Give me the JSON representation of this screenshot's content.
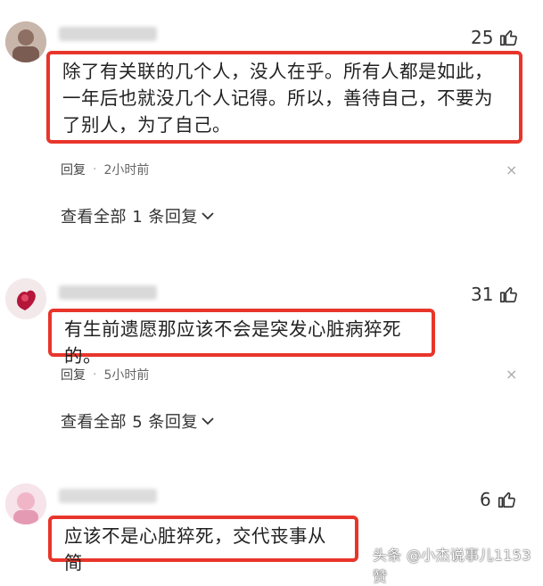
{
  "comments": [
    {
      "likes": "25",
      "text": "除了有关联的几个人，没人在乎。所有人都是如此，一年后也就没几个人记得。所以，善待自己，不要为了别人，为了自己。",
      "reply_label": "回复",
      "time": "2小时前",
      "view_all": "查看全部 1 条回复"
    },
    {
      "likes": "31",
      "text": "有生前遗愿那应该不会是突发心脏病猝死的。",
      "reply_label": "回复",
      "time": "5小时前",
      "view_all": "查看全部 5 条回复"
    },
    {
      "likes": "6",
      "text": "应该不是心脏猝死，交代丧事从简"
    }
  ],
  "watermark": "头条 @小杰说事儿1153赞",
  "colors": {
    "highlight": "#e8352b"
  }
}
